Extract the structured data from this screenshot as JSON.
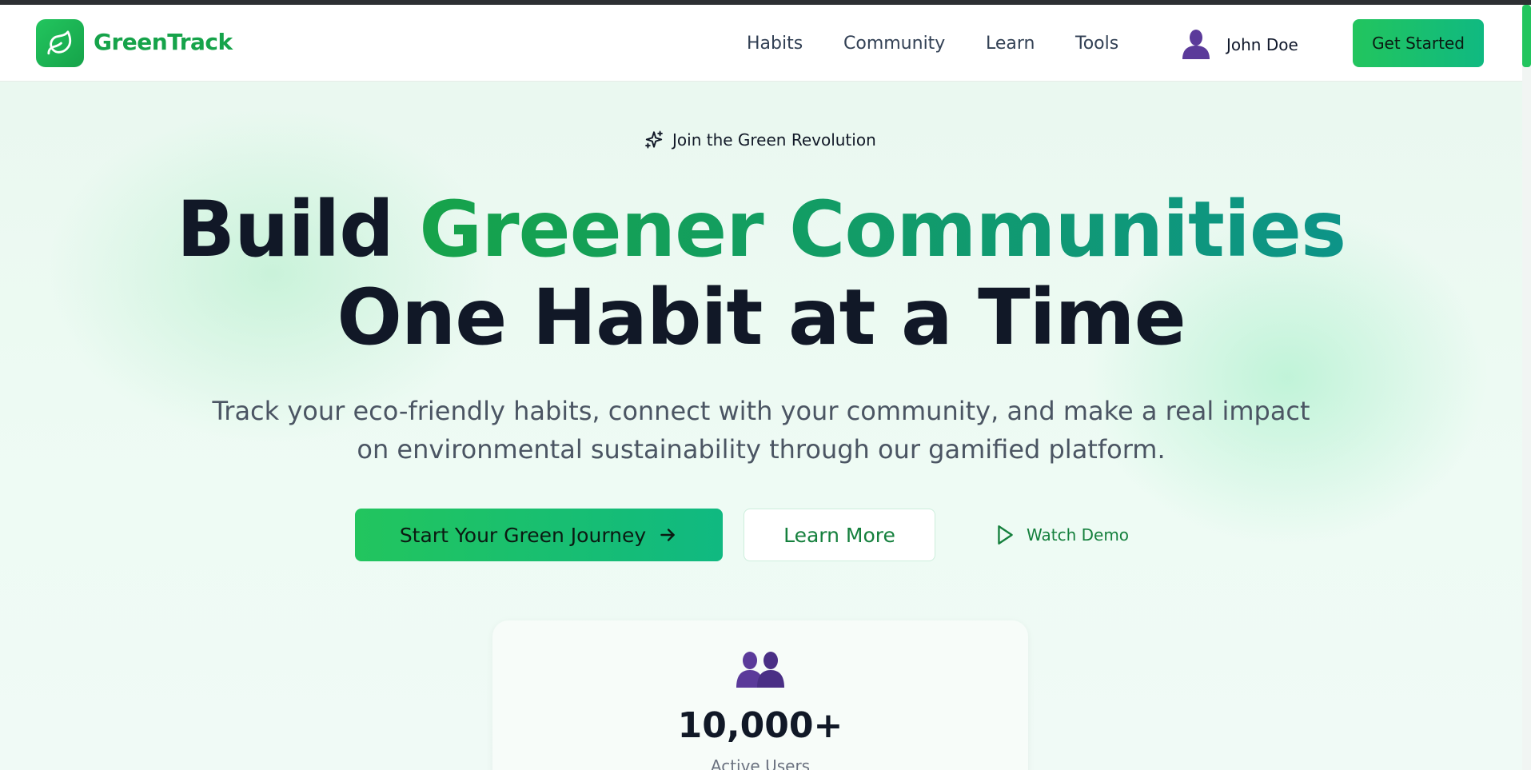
{
  "brand": {
    "name": "GreenTrack",
    "logo_icon": "leaf-icon",
    "accent": "#22c55e"
  },
  "nav": {
    "items": [
      "Habits",
      "Community",
      "Learn",
      "Tools"
    ]
  },
  "user": {
    "name": "John Doe",
    "icon": "user-avatar-icon"
  },
  "header": {
    "cta_label": "Get Started"
  },
  "hero": {
    "badge": "Join the Green Revolution",
    "headline_part1": "Build ",
    "headline_highlight": "Greener Communities",
    "headline_line2": "One Habit at a Time",
    "subtitle": "Track your eco-friendly habits, connect with your community, and make a real impact on environmental sustainability through our gamified platform.",
    "primary_cta": "Start Your Green Journey",
    "secondary_cta": "Learn More",
    "demo_link": "Watch Demo"
  },
  "stats": {
    "value": "10,000+",
    "label": "Active Users",
    "icon": "users-icon"
  }
}
